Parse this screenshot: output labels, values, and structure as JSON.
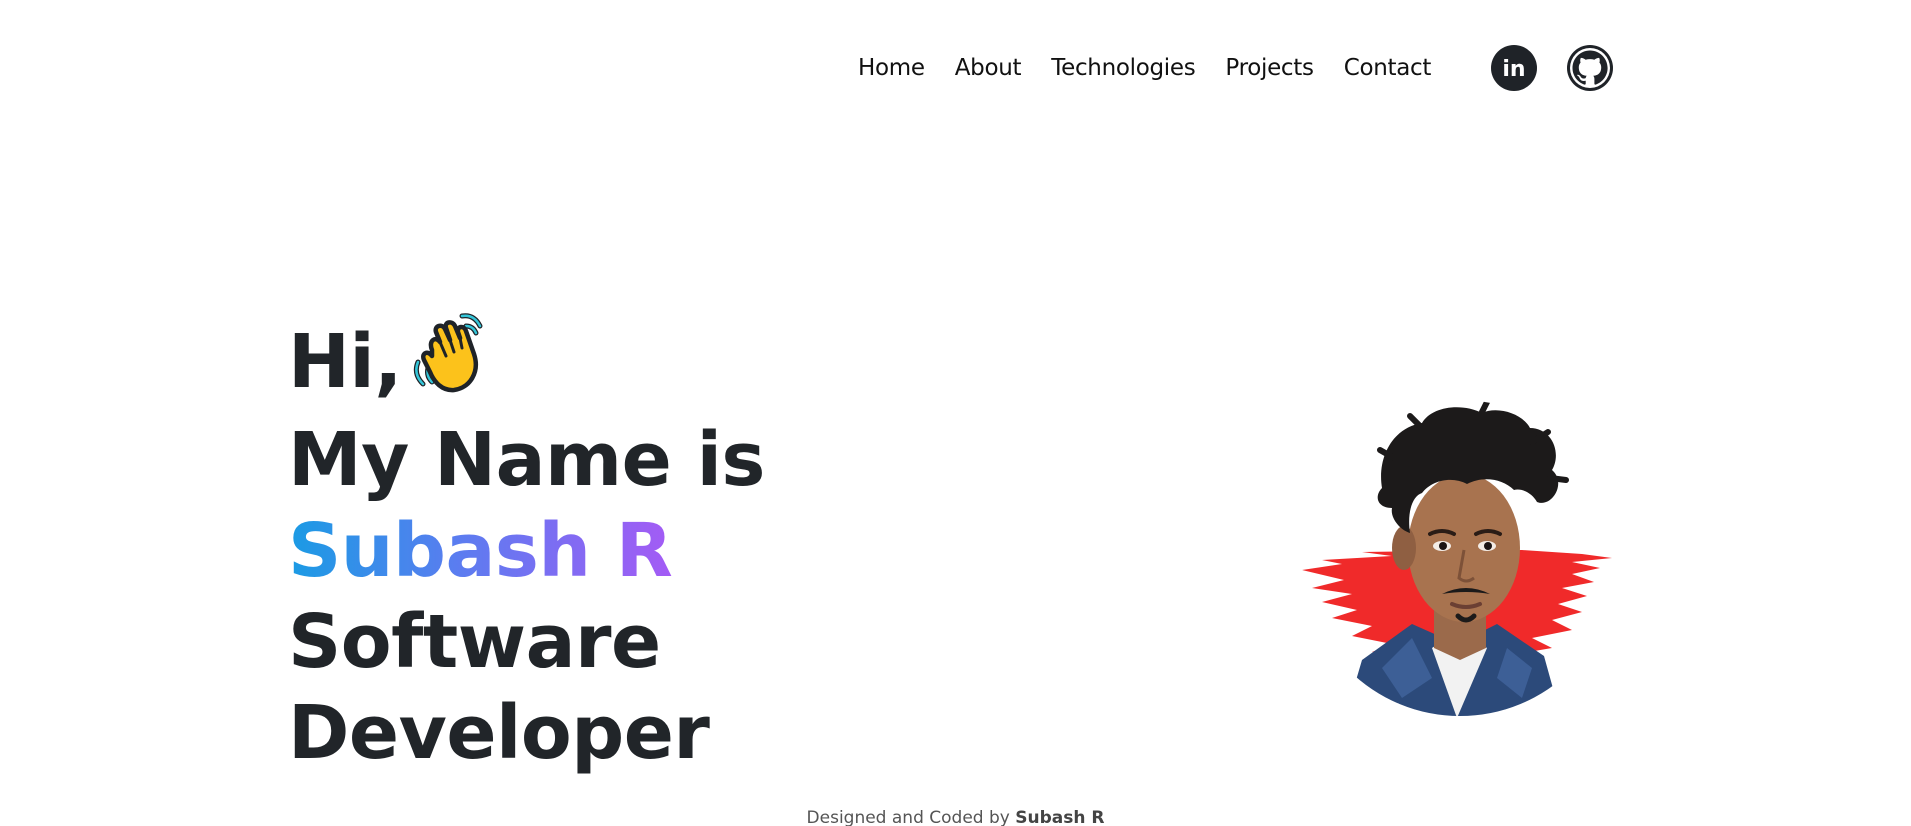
{
  "nav": {
    "links": [
      "Home",
      "About",
      "Technologies",
      "Projects",
      "Contact"
    ],
    "social": [
      {
        "icon": "linkedin-icon",
        "label": "in"
      },
      {
        "icon": "github-icon"
      }
    ]
  },
  "hero": {
    "greeting": "Hi,",
    "wave_icon": "waving-hand-icon",
    "intro": "My Name is",
    "name": "Subash R",
    "role_line1": "Software",
    "role_line2": "Developer"
  },
  "profile": {
    "icon": "profile-photo"
  },
  "footer": {
    "prefix": "Designed and Coded by",
    "author": "Subash R"
  },
  "colors": {
    "text": "#212529",
    "name_gradient_start": "#1a9be4",
    "name_gradient_end": "#a45bf5",
    "brush_red": "#f02a2a"
  }
}
